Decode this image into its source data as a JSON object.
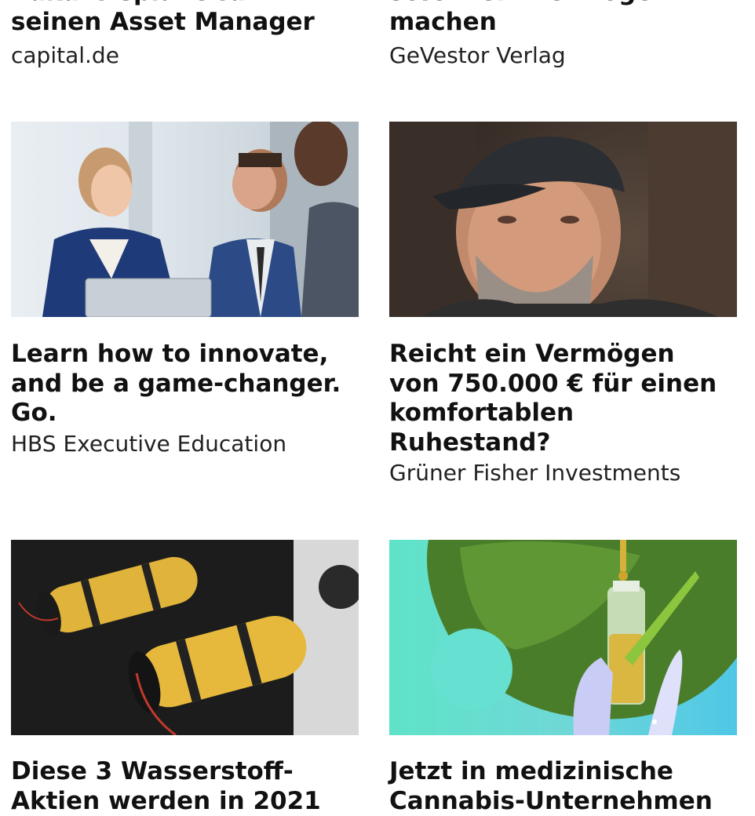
{
  "cards": [
    {
      "title_lines": [
        "Zukunftspläne für",
        "seinen Asset Manager"
      ],
      "source": "capital.de"
    },
    {
      "title_lines": [
        "sofort ein Vermögen",
        "machen"
      ],
      "source": "GeVestor Verlag"
    },
    {
      "title_lines": [
        "Learn how to innovate,",
        "and be a game-changer.",
        "Go."
      ],
      "source": "HBS Executive Education",
      "image": "business-meeting-tablet-image"
    },
    {
      "title_lines": [
        "Reicht ein Vermögen",
        "von 750.000 € für einen",
        "komfortablen",
        "Ruhestand?"
      ],
      "source": "Grüner Fisher Investments",
      "image": "man-with-cap-portrait-image"
    },
    {
      "title_lines": [
        "Diese 3 Wasserstoff-",
        "Aktien werden in 2021"
      ],
      "source": "",
      "image": "hydrogen-tanks-image"
    },
    {
      "title_lines": [
        "Jetzt in medizinische",
        "Cannabis-Unternehmen"
      ],
      "source": "",
      "image": "cannabis-oil-image"
    }
  ]
}
